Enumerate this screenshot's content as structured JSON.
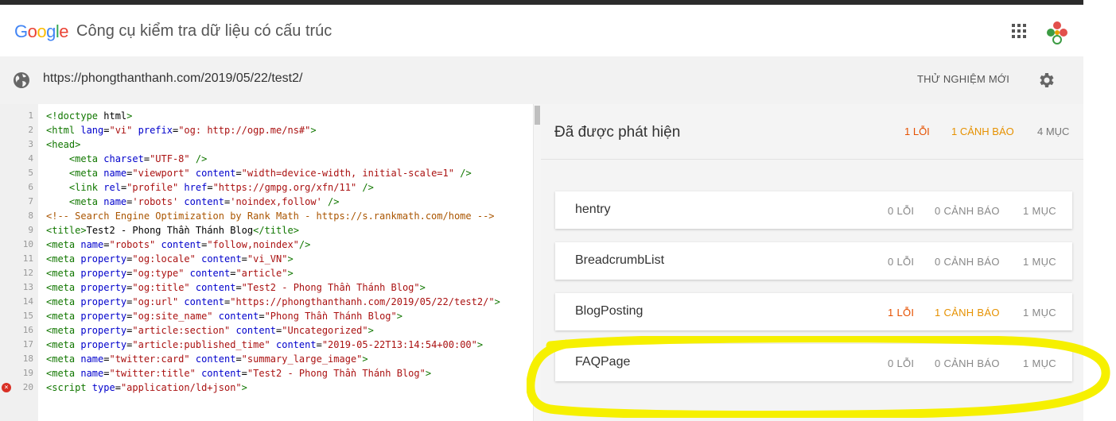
{
  "header": {
    "logo_text": "Google",
    "title": "Công cụ kiểm tra dữ liệu có cấu trúc",
    "apps_icon": "apps-grid-icon",
    "account_icon": "account-logo-icon"
  },
  "urlbar": {
    "url": "https://phongthanthanh.com/2019/05/22/test2/",
    "new_test_label": "THỬ NGHIỆM MỚI",
    "globe_icon": "globe-icon",
    "settings_icon": "gear-icon"
  },
  "code": {
    "lines": [
      "<!doctype html>",
      "<html lang=\"vi\" prefix=\"og: http://ogp.me/ns#\">",
      "<head>",
      "    <meta charset=\"UTF-8\" />",
      "    <meta name=\"viewport\" content=\"width=device-width, initial-scale=1\" />",
      "    <link rel=\"profile\" href=\"https://gmpg.org/xfn/11\" />",
      "    <meta name='robots' content='noindex,follow' />",
      "<!-- Search Engine Optimization by Rank Math - https://s.rankmath.com/home -->",
      "<title>Test2 - Phong Thần Thánh Blog</title>",
      "<meta name=\"robots\" content=\"follow,noindex\"/>",
      "<meta property=\"og:locale\" content=\"vi_VN\">",
      "<meta property=\"og:type\" content=\"article\">",
      "<meta property=\"og:title\" content=\"Test2 - Phong Thần Thánh Blog\">",
      "<meta property=\"og:url\" content=\"https://phongthanthanh.com/2019/05/22/test2/\">",
      "<meta property=\"og:site_name\" content=\"Phong Thần Thánh Blog\">",
      "<meta property=\"article:section\" content=\"Uncategorized\">",
      "<meta property=\"article:published_time\" content=\"2019-05-22T13:14:54+00:00\">",
      "<meta name=\"twitter:card\" content=\"summary_large_image\">",
      "<meta name=\"twitter:title\" content=\"Test2 - Phong Thần Thánh Blog\">",
      "<script type=\"application/ld+json\">"
    ],
    "line_numbers": [
      "1",
      "2",
      "3",
      "4",
      "5",
      "6",
      "7",
      "8",
      "9",
      "10",
      "11",
      "12",
      "13",
      "14",
      "15",
      "16",
      "17",
      "18",
      "19",
      "20"
    ],
    "error_line": "20"
  },
  "results": {
    "title": "Đã được phát hiện",
    "errors": "1 LỖI",
    "warnings": "1 CẢNH BÁO",
    "items": "4 MỤC",
    "cards": [
      {
        "name": "hentry",
        "errors": "0 LỖI",
        "warnings": "0 CẢNH BÁO",
        "items": "1 MỤC",
        "alert": false
      },
      {
        "name": "BreadcrumbList",
        "errors": "0 LỖI",
        "warnings": "0 CẢNH BÁO",
        "items": "1 MỤC",
        "alert": false
      },
      {
        "name": "BlogPosting",
        "errors": "1 LỖI",
        "warnings": "1 CẢNH BÁO",
        "items": "1 MỤC",
        "alert": true
      },
      {
        "name": "FAQPage",
        "errors": "0 LỖI",
        "warnings": "0 CẢNH BÁO",
        "items": "1 MỤC",
        "alert": false
      }
    ]
  },
  "colors": {
    "error": "#e65100",
    "warning": "#e69100",
    "highlight": "#f6f000"
  }
}
